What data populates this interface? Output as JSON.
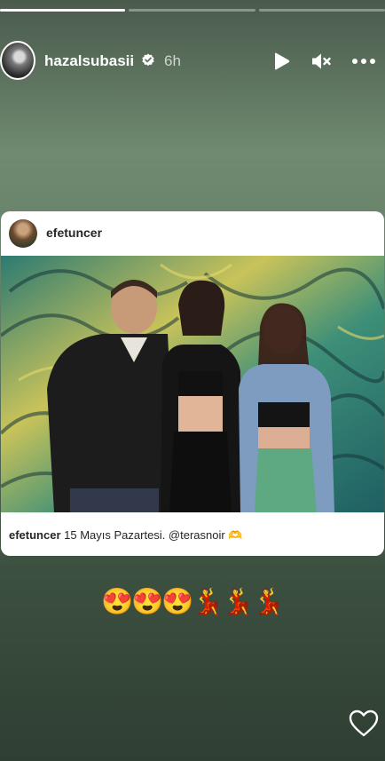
{
  "story": {
    "segments": [
      {
        "progress": 1.0
      },
      {
        "progress": 0.0
      },
      {
        "progress": 0.0
      }
    ]
  },
  "header": {
    "username": "hazalsubasii",
    "verified": true,
    "time": "6h",
    "icons": [
      "play-icon",
      "mute-icon",
      "more-icon"
    ]
  },
  "post": {
    "username": "efetuncer",
    "caption_user": "efetuncer",
    "caption_text": " 15 Mayıs Pazartesi. @terasnoir 🫶"
  },
  "emojis": "😍😍😍💃💃💃",
  "colors": {
    "background_top": "#6f8a70",
    "background_bottom": "#2f3f33",
    "card": "#ffffff",
    "verified": "#ffffff"
  }
}
